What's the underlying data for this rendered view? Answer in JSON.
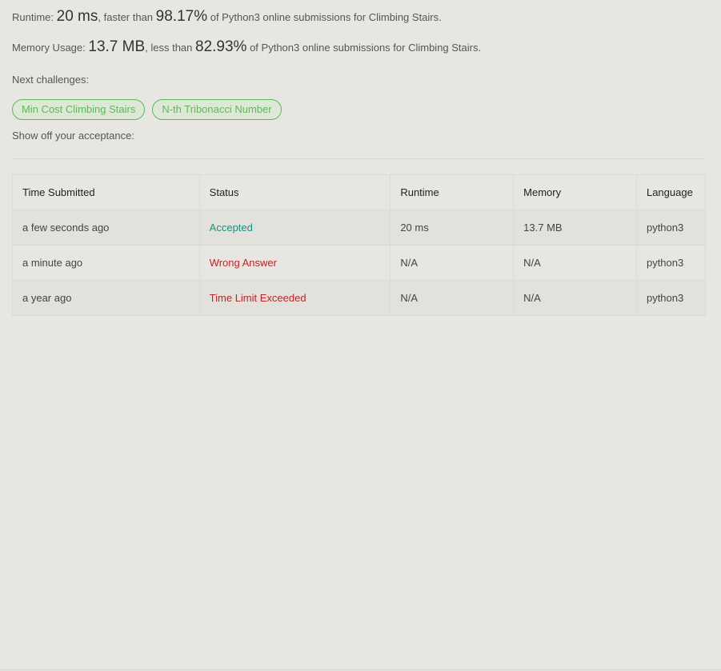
{
  "stats": {
    "runtime": {
      "label": "Runtime: ",
      "value": "20 ms",
      "mid": ", faster than ",
      "percent": "98.17%",
      "suffix": " of Python3 online submissions for Climbing Stairs."
    },
    "memory": {
      "label": "Memory Usage: ",
      "value": "13.7 MB",
      "mid": ", less than ",
      "percent": "82.93%",
      "suffix": " of Python3 online submissions for Climbing Stairs."
    }
  },
  "next_challenges": {
    "label": "Next challenges:",
    "items": [
      "Min Cost Climbing Stairs",
      "N-th Tribonacci Number"
    ]
  },
  "show_off": {
    "label": "Show off your acceptance:"
  },
  "submissions": {
    "columns": [
      "Time Submitted",
      "Status",
      "Runtime",
      "Memory",
      "Language"
    ],
    "rows": [
      {
        "time": "a few seconds ago",
        "status": "Accepted",
        "runtime": "20 ms",
        "memory": "13.7 MB",
        "language": "python3"
      },
      {
        "time": "a minute ago",
        "status": "Wrong Answer",
        "runtime": "N/A",
        "memory": "N/A",
        "language": "python3"
      },
      {
        "time": "a year ago",
        "status": "Time Limit Exceeded",
        "runtime": "N/A",
        "memory": "N/A",
        "language": "python3"
      }
    ]
  },
  "colors": {
    "background": "#e8e6e0",
    "accepted": "#17907a",
    "error": "#b9262b",
    "chip_border": "#5cb85c"
  }
}
